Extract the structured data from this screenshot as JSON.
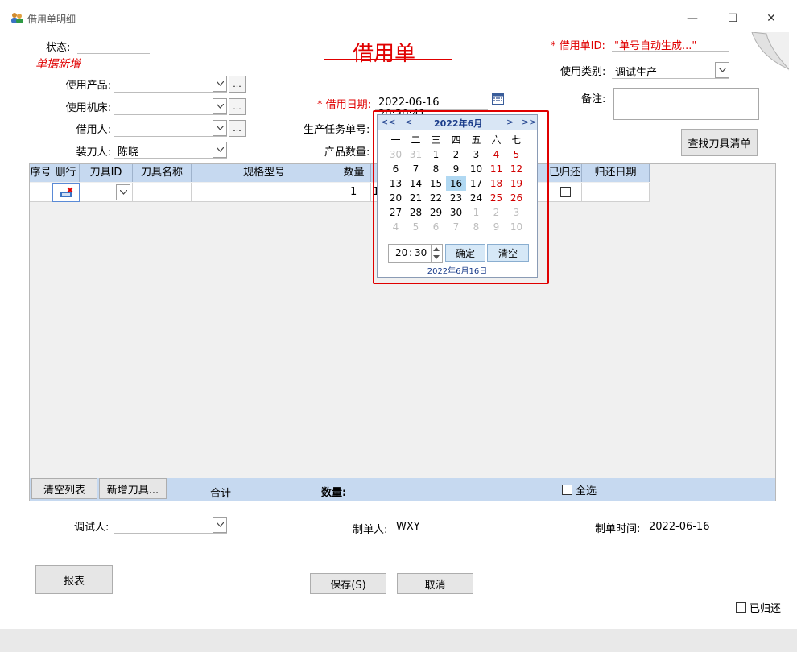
{
  "window": {
    "title": "借用单明细",
    "controls": {
      "minimize": "—",
      "maximize": "☐",
      "close": "✕"
    }
  },
  "form": {
    "heading": "借用单",
    "status_label": "状态:",
    "status_value": "单据新增",
    "id_label": "* 借用单ID:",
    "id_value": "\"单号自动生成...\"",
    "product_label": "使用产品:",
    "product_value": "",
    "machine_label": "使用机床:",
    "machine_value": "",
    "borrower_label": "借用人:",
    "borrower_value": "",
    "installer_label": "装刀人:",
    "installer_value": "陈晓",
    "date_label": "* 借用日期:",
    "date_value": "2022-06-16 20:30:41",
    "task_label": "生产任务单号:",
    "qty_label": "产品数量:",
    "category_label": "使用类别:",
    "category_value": "调试生产",
    "remark_label": "备注:",
    "find_button": "查找刀具清单",
    "ellipsis": "..."
  },
  "grid": {
    "columns": [
      "序号",
      "删行",
      "刀具ID",
      "刀具名称",
      "规格型号",
      "数量",
      "",
      "已归还",
      "归还日期"
    ],
    "rows": [
      {
        "seq": "",
        "tool_id": "",
        "tool_name": "",
        "spec": "",
        "qty": "1",
        "extra": "1",
        "returned": false,
        "return_date": ""
      }
    ],
    "footer": {
      "clear_button": "清空列表",
      "add_button": "新增刀具...",
      "total_label": "合计",
      "qty_label": "数量:",
      "select_all_label": "全选"
    }
  },
  "bottom": {
    "tester_label": "调试人:",
    "tester_value": "",
    "maker_label": "制单人:",
    "maker_value": "WXY",
    "make_time_label": "制单时间:",
    "make_time_value": "2022-06-16",
    "report_button": "报表",
    "save_button": "保存(S)",
    "cancel_button": "取消",
    "returned_label": "已归还"
  },
  "calendar": {
    "nav_prev_year": "<<",
    "nav_prev_month": "<",
    "month_title": "2022年6月",
    "nav_next_month": ">",
    "nav_next_year": ">>",
    "weekdays": [
      "一",
      "二",
      "三",
      "四",
      "五",
      "六",
      "七"
    ],
    "weeks": [
      [
        "30",
        "31",
        "1",
        "2",
        "3",
        "4",
        "5"
      ],
      [
        "6",
        "7",
        "8",
        "9",
        "10",
        "11",
        "12"
      ],
      [
        "13",
        "14",
        "15",
        "16",
        "17",
        "18",
        "19"
      ],
      [
        "20",
        "21",
        "22",
        "23",
        "24",
        "25",
        "26"
      ],
      [
        "27",
        "28",
        "29",
        "30",
        "1",
        "2",
        "3"
      ],
      [
        "4",
        "5",
        "6",
        "7",
        "8",
        "9",
        "10"
      ]
    ],
    "time_hour": "20",
    "time_sep": ":",
    "time_minute": "30",
    "ok_button": "确定",
    "clear_button": "清空",
    "today_text": "2022年6月16日",
    "selected_day": "16"
  },
  "colors": {
    "accent_red": "#e00000",
    "grid_header": "#c6d9f0",
    "calendar_header": "#d9e6f5",
    "selected_day": "#b0d8f2"
  }
}
